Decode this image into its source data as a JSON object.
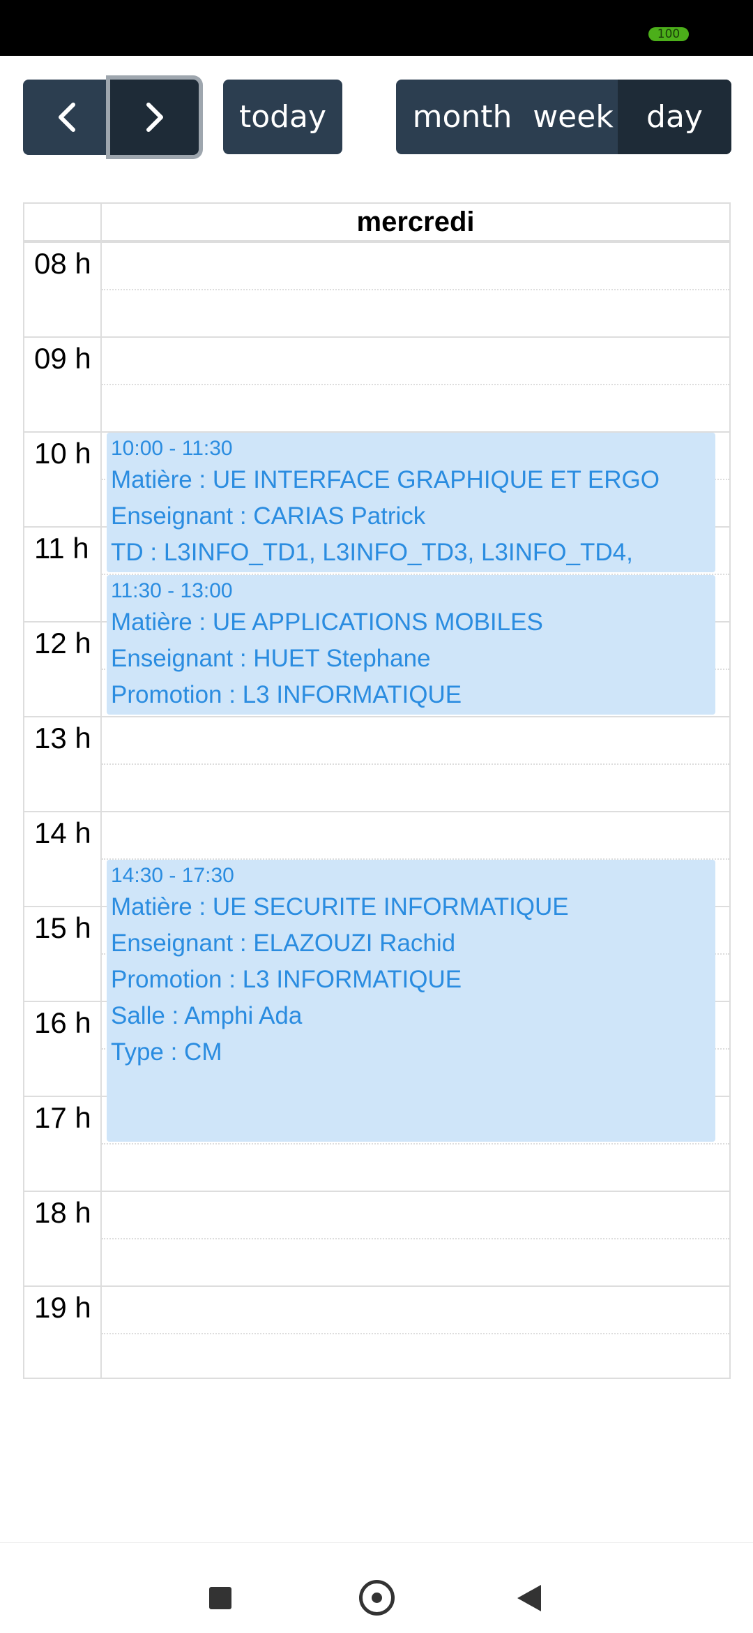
{
  "status_bar": {
    "battery": "100"
  },
  "toolbar": {
    "prev_icon": "chevron-left-icon",
    "next_icon": "chevron-right-icon",
    "today_label": "today",
    "views": {
      "month": "month",
      "week": "week",
      "day": "day"
    },
    "active_view": "day"
  },
  "calendar": {
    "day_header": "mercredi",
    "hours": [
      "08 h",
      "09 h",
      "10 h",
      "11 h",
      "12 h",
      "13 h",
      "14 h",
      "15 h",
      "16 h",
      "17 h",
      "18 h",
      "19 h"
    ],
    "events": [
      {
        "time": "10:00 - 11:30",
        "start": "10:00",
        "end": "11:30",
        "lines": [
          "Matière : UE INTERFACE GRAPHIQUE ET ERGO",
          "Enseignant : CARIAS Patrick",
          "TD : L3INFO_TD1, L3INFO_TD3, L3INFO_TD4,"
        ]
      },
      {
        "time": "11:30 - 13:00",
        "start": "11:30",
        "end": "13:00",
        "lines": [
          "Matière : UE APPLICATIONS MOBILES",
          "Enseignant : HUET Stephane",
          "Promotion : L3 INFORMATIQUE"
        ]
      },
      {
        "time": "14:30 - 17:30",
        "start": "14:30",
        "end": "17:30",
        "lines": [
          "Matière : UE SECURITE INFORMATIQUE",
          "Enseignant : ELAZOUZI Rachid",
          "Promotion : L3 INFORMATIQUE",
          "Salle : Amphi Ada",
          "Type : CM"
        ]
      }
    ]
  },
  "colors": {
    "button_bg": "#2c3e50",
    "button_active_bg": "#1e2b37",
    "event_bg": "#cfe5f9",
    "event_text": "#2a8ce0",
    "grid_line": "#dddddd"
  },
  "nav_bar": {
    "recent_icon": "square-recent-apps-icon",
    "home_icon": "circle-home-icon",
    "back_icon": "triangle-back-icon"
  }
}
